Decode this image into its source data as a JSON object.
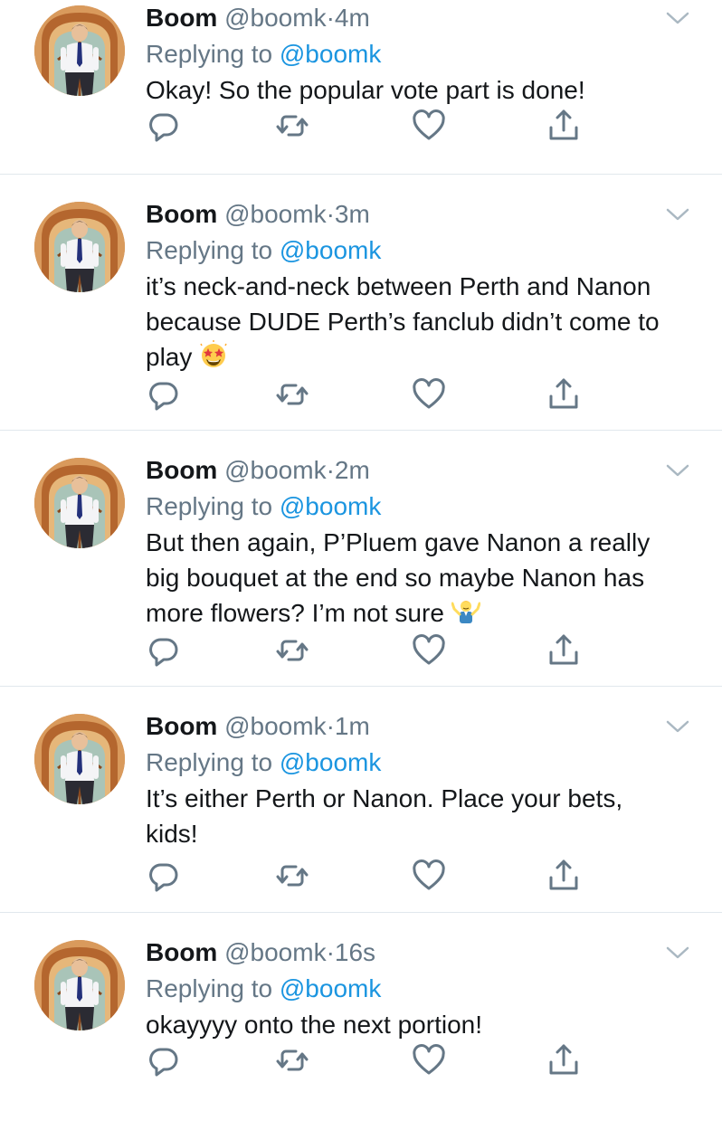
{
  "colors": {
    "text": "#14171a",
    "secondary": "#657786",
    "link": "#1b95e0",
    "divider": "#e1e8ed",
    "icon": "#657786"
  },
  "icons": [
    "chevron-down-icon",
    "reply-icon",
    "retweet-icon",
    "like-icon",
    "share-icon"
  ],
  "tweets": [
    {
      "display_name": "Boom",
      "handle": "@boomk",
      "separator": "·",
      "time": "4m",
      "replying_prefix": "Replying to",
      "replying_to": "@boomk",
      "text": "Okay! So the popular vote part is done!"
    },
    {
      "display_name": "Boom",
      "handle": "@boomk",
      "separator": "·",
      "time": "3m",
      "replying_prefix": "Replying to",
      "replying_to": "@boomk",
      "text": "it’s neck-and-neck between Perth and Nanon because DUDE Perth’s fanclub didn’t come to play",
      "emoji": "star-struck"
    },
    {
      "display_name": "Boom",
      "handle": "@boomk",
      "separator": "·",
      "time": "2m",
      "replying_prefix": "Replying to",
      "replying_to": "@boomk",
      "text": "But then again, P’Pluem gave Nanon a really big bouquet at the end so maybe Nanon has more flowers? I’m not sure",
      "emoji": "man-shrugging"
    },
    {
      "display_name": "Boom",
      "handle": "@boomk",
      "separator": "·",
      "time": "1m",
      "replying_prefix": "Replying to",
      "replying_to": "@boomk",
      "text": "It’s either Perth or Nanon. Place your bets, kids!"
    },
    {
      "display_name": "Boom",
      "handle": "@boomk",
      "separator": "·",
      "time": "16s",
      "replying_prefix": "Replying to",
      "replying_to": "@boomk",
      "text": "okayyyy onto the next portion!"
    }
  ]
}
